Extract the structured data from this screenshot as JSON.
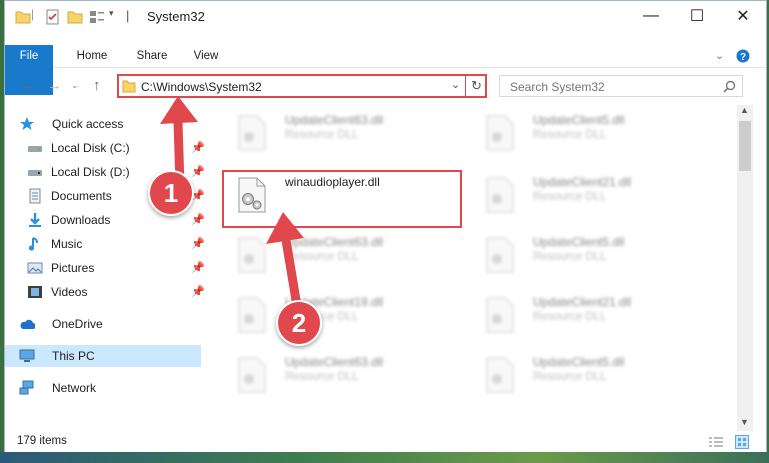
{
  "window": {
    "title": "System32",
    "minimize_glyph": "—",
    "maximize_glyph": "☐",
    "close_glyph": "✕"
  },
  "ribbon": {
    "tabs": [
      "File",
      "Home",
      "Share",
      "View"
    ]
  },
  "address_bar": {
    "path": "C:\\Windows\\System32",
    "search_placeholder": "Search System32"
  },
  "sidebar": {
    "quick_access": "Quick access",
    "items": [
      {
        "label": "Local Disk (C:)",
        "icon": "drive-icon",
        "pinned": true
      },
      {
        "label": "Local Disk (D:)",
        "icon": "drive-icon",
        "pinned": true
      },
      {
        "label": "Documents",
        "icon": "documents-icon",
        "pinned": true
      },
      {
        "label": "Downloads",
        "icon": "download-icon",
        "pinned": true
      },
      {
        "label": "Music",
        "icon": "music-icon",
        "pinned": true
      },
      {
        "label": "Pictures",
        "icon": "pictures-icon",
        "pinned": true
      },
      {
        "label": "Videos",
        "icon": "videos-icon",
        "pinned": true
      }
    ],
    "onedrive": "OneDrive",
    "this_pc": "This PC",
    "network": "Network"
  },
  "files": {
    "left_column": [
      {
        "name": "UpdateClient63.dll",
        "type": "Resource DLL"
      },
      {
        "name": "winaudioplayer.dll",
        "type": ""
      },
      {
        "name": "UpdateClient63.dll",
        "type": "Resource DLL"
      },
      {
        "name": "UpdateClient19.dll",
        "type": "Resource DLL"
      },
      {
        "name": "UpdateClient63.dll",
        "type": "Resource DLL"
      }
    ],
    "right_column": [
      {
        "name": "UpdateClient5.dll",
        "type": "Resource DLL"
      },
      {
        "name": "UpdateClient21.dll",
        "type": "Resource DLL"
      },
      {
        "name": "UpdateClient5.dll",
        "type": "Resource DLL"
      },
      {
        "name": "UpdateClient21.dll",
        "type": "Resource DLL"
      },
      {
        "name": "UpdateClient5.dll",
        "type": "Resource DLL"
      }
    ]
  },
  "status_bar": {
    "item_count": "179 items"
  },
  "annotations": {
    "step1": "1",
    "step2": "2",
    "accent_color": "#e0484d"
  }
}
